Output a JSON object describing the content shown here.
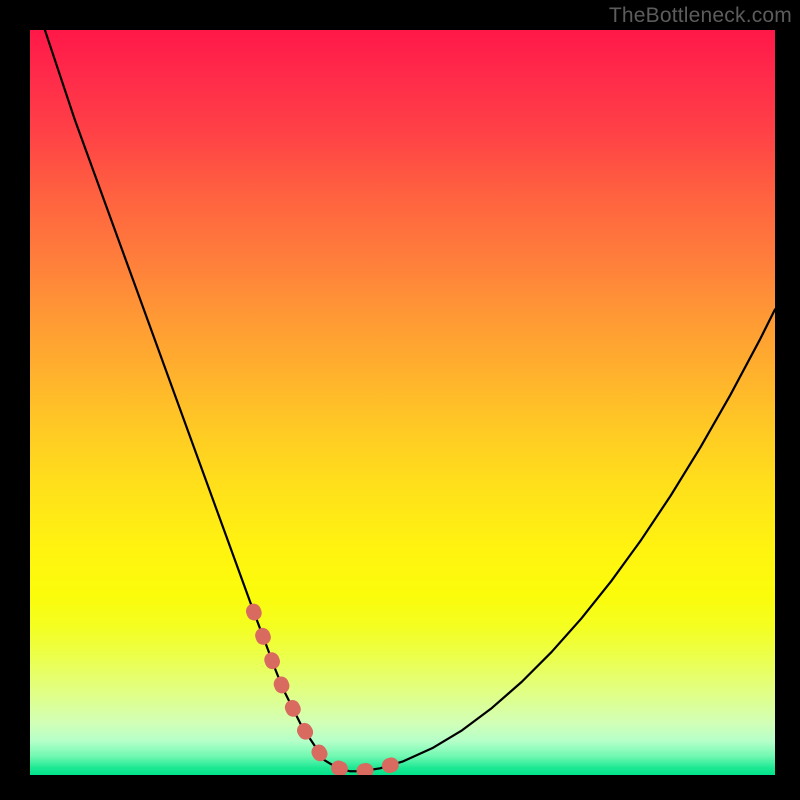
{
  "watermark": "TheBottleneck.com",
  "chart_data": {
    "type": "line",
    "title": "",
    "xlabel": "",
    "ylabel": "",
    "xlim": [
      0,
      100
    ],
    "ylim": [
      0,
      100
    ],
    "grid": false,
    "legend": false,
    "series": [
      {
        "name": "bottleneck-curve",
        "color": "#000000",
        "x": [
          2,
          4,
          6,
          8,
          10,
          12,
          14,
          16,
          18,
          20,
          22,
          24,
          26,
          28,
          30,
          31.5,
          33,
          34,
          35,
          36.5,
          39.5,
          41,
          42,
          43,
          44.5,
          47,
          50,
          54,
          58,
          62,
          66,
          70,
          74,
          78,
          82,
          86,
          90,
          94,
          98,
          100
        ],
        "y": [
          100,
          94,
          88,
          82.5,
          77,
          71.5,
          66,
          60.5,
          55,
          49.5,
          44,
          38.5,
          33,
          27.5,
          22,
          18,
          14,
          11.5,
          9.5,
          6.5,
          2,
          1.1,
          0.7,
          0.5,
          0.5,
          0.9,
          1.8,
          3.6,
          6,
          9,
          12.5,
          16.5,
          21,
          26,
          31.5,
          37.5,
          44,
          51,
          58.5,
          62.5
        ]
      },
      {
        "name": "highlight-segment",
        "color": "#d86a60",
        "x": [
          30,
          31.5,
          33,
          34,
          35,
          36.5,
          39.5,
          41,
          42,
          43,
          44.5,
          47,
          50
        ],
        "y": [
          22,
          18,
          14,
          11.5,
          9.5,
          6.5,
          2,
          1.1,
          0.7,
          0.5,
          0.5,
          0.9,
          1.8
        ]
      }
    ],
    "annotations": []
  },
  "colors": {
    "curve": "#000000",
    "highlight": "#d86a60",
    "background_top": "#ff1848",
    "background_bottom": "#00e38a",
    "frame": "#000000"
  }
}
